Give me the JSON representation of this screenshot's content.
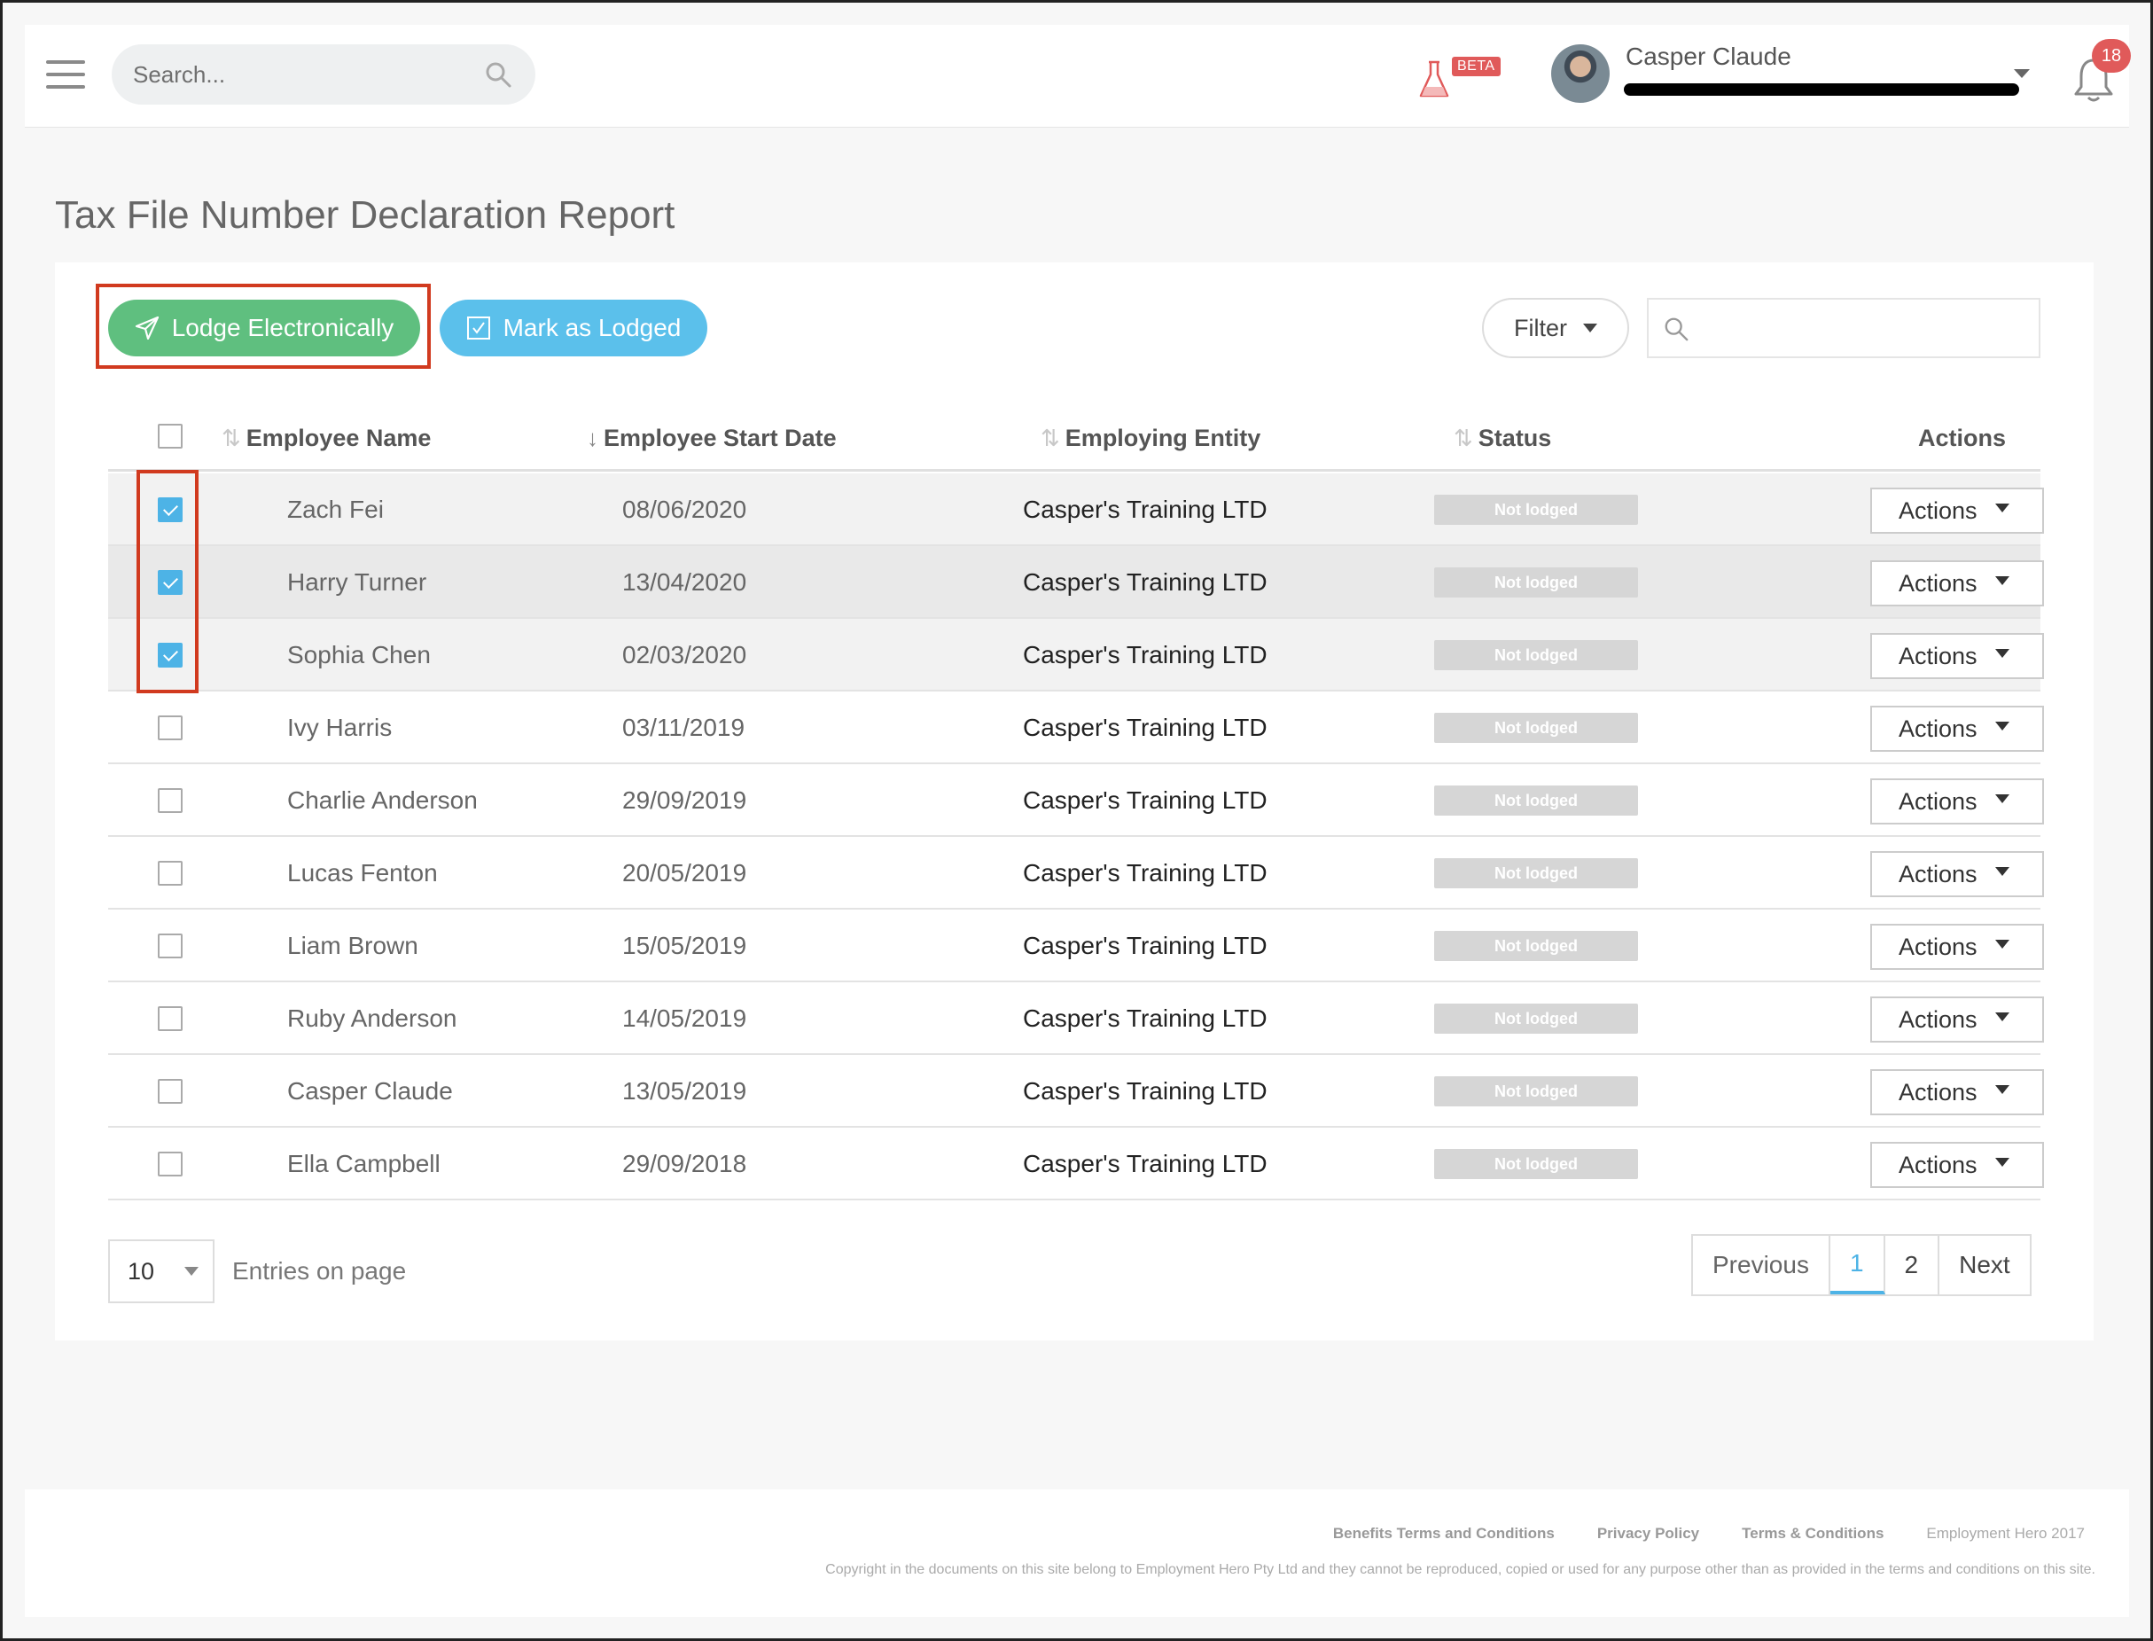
{
  "header": {
    "search_placeholder": "Search...",
    "beta_label": "BETA",
    "user_name": "Casper Claude",
    "notification_count": "18"
  },
  "page": {
    "title": "Tax File Number Declaration Report"
  },
  "toolbar": {
    "lodge_label": "Lodge Electronically",
    "mark_label": "Mark as Lodged",
    "filter_label": "Filter",
    "table_search_placeholder": ""
  },
  "table": {
    "columns": {
      "name": "Employee Name",
      "start_date": "Employee Start Date",
      "entity": "Employing Entity",
      "status": "Status",
      "actions": "Actions"
    },
    "rows": [
      {
        "name": "Zach Fei",
        "date": "08/06/2020",
        "entity": "Casper's Training LTD",
        "status": "Not lodged",
        "action": "Actions",
        "checked": true
      },
      {
        "name": "Harry Turner",
        "date": "13/04/2020",
        "entity": "Casper's Training LTD",
        "status": "Not lodged",
        "action": "Actions",
        "checked": true
      },
      {
        "name": "Sophia Chen",
        "date": "02/03/2020",
        "entity": "Casper's Training LTD",
        "status": "Not lodged",
        "action": "Actions",
        "checked": true
      },
      {
        "name": "Ivy Harris",
        "date": "03/11/2019",
        "entity": "Casper's Training LTD",
        "status": "Not lodged",
        "action": "Actions",
        "checked": false
      },
      {
        "name": "Charlie Anderson",
        "date": "29/09/2019",
        "entity": "Casper's Training LTD",
        "status": "Not lodged",
        "action": "Actions",
        "checked": false
      },
      {
        "name": "Lucas Fenton",
        "date": "20/05/2019",
        "entity": "Casper's Training LTD",
        "status": "Not lodged",
        "action": "Actions",
        "checked": false
      },
      {
        "name": "Liam Brown",
        "date": "15/05/2019",
        "entity": "Casper's Training LTD",
        "status": "Not lodged",
        "action": "Actions",
        "checked": false
      },
      {
        "name": "Ruby Anderson",
        "date": "14/05/2019",
        "entity": "Casper's Training LTD",
        "status": "Not lodged",
        "action": "Actions",
        "checked": false
      },
      {
        "name": "Casper Claude",
        "date": "13/05/2019",
        "entity": "Casper's Training LTD",
        "status": "Not lodged",
        "action": "Actions",
        "checked": false
      },
      {
        "name": "Ella Campbell",
        "date": "29/09/2018",
        "entity": "Casper's Training LTD",
        "status": "Not lodged",
        "action": "Actions",
        "checked": false
      }
    ]
  },
  "pagination": {
    "per_page": "10",
    "entries_label": "Entries on page",
    "previous": "Previous",
    "pages": [
      "1",
      "2"
    ],
    "next": "Next"
  },
  "footer": {
    "links": [
      "Benefits Terms and Conditions",
      "Privacy Policy",
      "Terms & Conditions"
    ],
    "brand": "Employment Hero 2017",
    "copyright": "Copyright in the documents on this site belong to Employment Hero Pty Ltd and they cannot be reproduced, copied or used for any purpose other than as provided in the terms and conditions on this site."
  },
  "colors": {
    "lodge_button": "#5fbf7f",
    "mark_button": "#5bc0eb",
    "highlight": "#d13a1f",
    "checkbox_on": "#4db3e6",
    "badge": "#e05a5a"
  },
  "icons": [
    "hamburger-icon",
    "search-icon",
    "flask-icon",
    "send-icon",
    "checkbox-icon",
    "bell-icon",
    "sort-icon",
    "chevron-down-icon"
  ]
}
